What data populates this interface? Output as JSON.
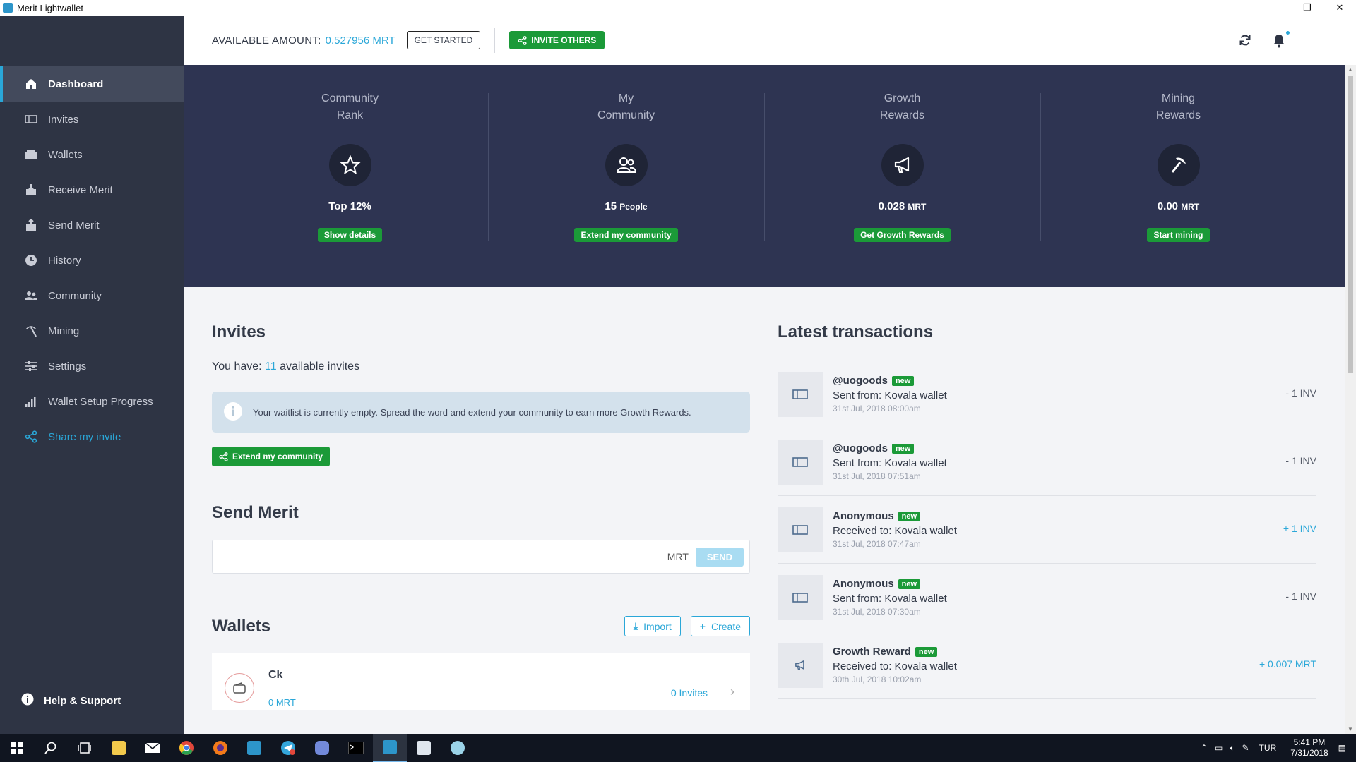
{
  "window": {
    "title": "Merit Lightwallet",
    "controls": [
      "–",
      "❐",
      "✕"
    ]
  },
  "sidebar": {
    "items": [
      {
        "label": "Dashboard",
        "icon": "home-icon"
      },
      {
        "label": "Invites",
        "icon": "ticket-icon"
      },
      {
        "label": "Wallets",
        "icon": "wallet-icon"
      },
      {
        "label": "Receive Merit",
        "icon": "receive-icon"
      },
      {
        "label": "Send Merit",
        "icon": "send-icon"
      },
      {
        "label": "History",
        "icon": "clock-icon"
      },
      {
        "label": "Community",
        "icon": "people-icon"
      },
      {
        "label": "Mining",
        "icon": "pickaxe-icon"
      },
      {
        "label": "Settings",
        "icon": "sliders-icon"
      },
      {
        "label": "Wallet Setup Progress",
        "icon": "bars-icon"
      },
      {
        "label": "Share my invite",
        "icon": "share-icon"
      }
    ],
    "help": "Help & Support"
  },
  "topbar": {
    "available_label": "AVAILABLE AMOUNT:",
    "available_value": "0.527956 MRT",
    "get_started": "GET STARTED",
    "invite_others": "INVITE OTHERS"
  },
  "stats": [
    {
      "title": "Community Rank",
      "value": "Top 12%",
      "unit": "",
      "button": "Show details",
      "icon": "star-icon"
    },
    {
      "title": "My Community",
      "value": "15",
      "unit": "People",
      "button": "Extend my community",
      "icon": "people-icon"
    },
    {
      "title": "Growth Rewards",
      "value": "0.028",
      "unit": "MRT",
      "button": "Get Growth Rewards",
      "icon": "megaphone-icon"
    },
    {
      "title": "Mining Rewards",
      "value": "0.00",
      "unit": "MRT",
      "button": "Start mining",
      "icon": "pickaxe-icon"
    }
  ],
  "invites": {
    "title": "Invites",
    "you_have_prefix": "You have:",
    "count": "11",
    "you_have_suffix": "available invites",
    "info": "Your waitlist is currently empty. Spread the word and extend your community to earn more Growth Rewards.",
    "extend_button": "Extend my community"
  },
  "send": {
    "title": "Send Merit",
    "placeholder": "",
    "unit": "MRT",
    "button": "SEND"
  },
  "wallets": {
    "title": "Wallets",
    "import": "Import",
    "create": "Create",
    "items": [
      {
        "name": "Ck",
        "balance": "0 MRT",
        "invites": "0 Invites"
      }
    ]
  },
  "transactions": {
    "title": "Latest transactions",
    "items": [
      {
        "who": "@uogoods",
        "badge": "new",
        "desc": "Sent from: Kovala wallet",
        "date": "31st Jul, 2018 08:00am",
        "amount": "- 1 INV",
        "positive": false,
        "icon": "ticket-icon"
      },
      {
        "who": "@uogoods",
        "badge": "new",
        "desc": "Sent from: Kovala wallet",
        "date": "31st Jul, 2018 07:51am",
        "amount": "- 1 INV",
        "positive": false,
        "icon": "ticket-icon"
      },
      {
        "who": "Anonymous",
        "badge": "new",
        "desc": "Received to: Kovala wallet",
        "date": "31st Jul, 2018 07:47am",
        "amount": "+ 1 INV",
        "positive": true,
        "icon": "ticket-icon"
      },
      {
        "who": "Anonymous",
        "badge": "new",
        "desc": "Sent from: Kovala wallet",
        "date": "31st Jul, 2018 07:30am",
        "amount": "- 1 INV",
        "positive": false,
        "icon": "ticket-icon"
      },
      {
        "who": "Growth Reward",
        "badge": "new",
        "desc": "Received to: Kovala wallet",
        "date": "30th Jul, 2018 10:02am",
        "amount": "+ 0.007 MRT",
        "positive": true,
        "icon": "megaphone-icon"
      }
    ]
  },
  "taskbar": {
    "apps": [
      {
        "name": "start-button",
        "color": "#ffffff"
      },
      {
        "name": "search-button",
        "color": "#ffffff"
      },
      {
        "name": "task-view-button",
        "color": "#ffffff"
      },
      {
        "name": "file-explorer-app",
        "color": "#f2c94c"
      },
      {
        "name": "mail-app",
        "color": "#ffffff"
      },
      {
        "name": "chrome-app",
        "color": "#e2473b"
      },
      {
        "name": "firefox-app",
        "color": "#f27a1a"
      },
      {
        "name": "merit-app",
        "color": "#2d95c9"
      },
      {
        "name": "telegram-app",
        "color": "#34a6db"
      },
      {
        "name": "discord-app",
        "color": "#7289da"
      },
      {
        "name": "terminal-app",
        "color": "#444a55"
      },
      {
        "name": "merit-lightwallet-app",
        "color": "#2d95c9"
      },
      {
        "name": "notepad-app",
        "color": "#dfe6ee"
      },
      {
        "name": "paint-app",
        "color": "#9bd3e8"
      }
    ],
    "lang": "TUR",
    "time": "5:41 PM",
    "date": "7/31/2018"
  }
}
